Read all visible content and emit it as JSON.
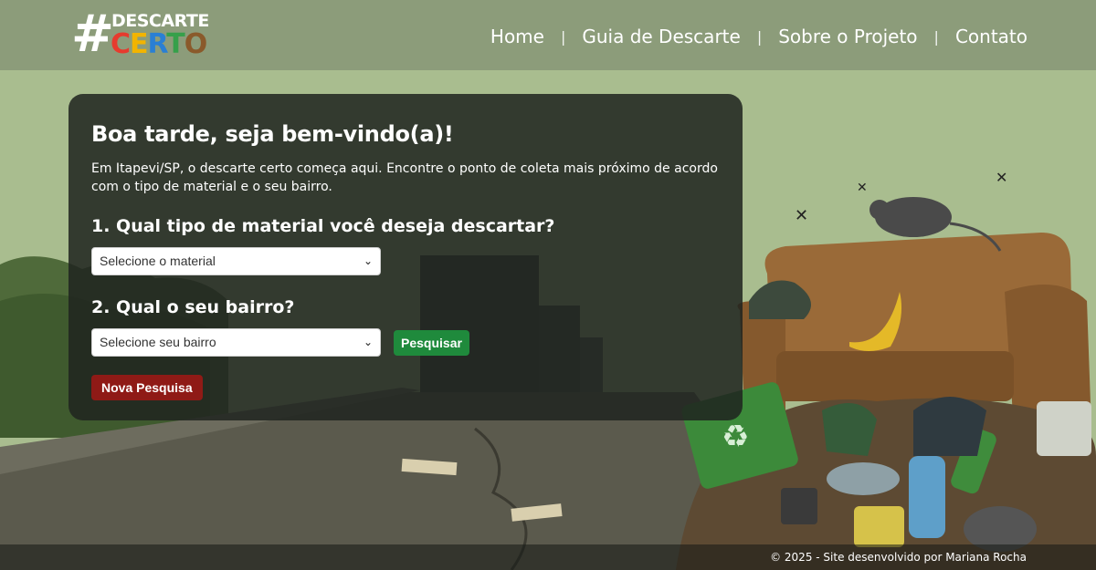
{
  "brand": {
    "hash": "#",
    "top": "DESCARTE",
    "bottom_letters": [
      "C",
      "E",
      "R",
      "T",
      "O"
    ],
    "bottom_colors": [
      "#e63b2e",
      "#f2b400",
      "#2a7fd4",
      "#36a04a",
      "#8a5a2b"
    ]
  },
  "nav": {
    "items": [
      "Home",
      "Guia de Descarte",
      "Sobre o Projeto",
      "Contato"
    ],
    "separator": "|"
  },
  "card": {
    "title": "Boa tarde, seja bem-vindo(a)!",
    "intro": "Em Itapevi/SP, o descarte certo começa aqui. Encontre o ponto de coleta mais próximo de acordo com o tipo de material e o seu bairro.",
    "q1": "1. Qual tipo de material você deseja descartar?",
    "material_select": "Selecione o material",
    "q2": "2. Qual o seu bairro?",
    "bairro_select": "Selecione seu bairro",
    "search_label": "Pesquisar",
    "new_search_label": "Nova Pesquisa"
  },
  "footer": {
    "text": "© 2025 - Site desenvolvido por Mariana Rocha"
  },
  "colors": {
    "header_bg": "#8c9c7a",
    "card_bg": "#202420",
    "search_button": "#1f8a3c",
    "new_search_button": "#8f1a16"
  }
}
